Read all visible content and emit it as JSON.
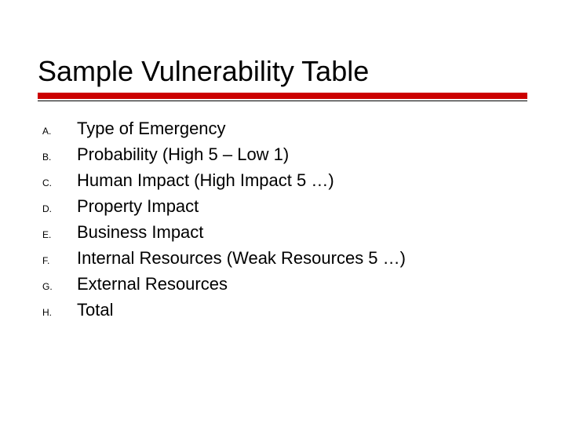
{
  "title": "Sample Vulnerability Table",
  "items": [
    {
      "marker": "A.",
      "text": "Type of Emergency"
    },
    {
      "marker": "B.",
      "text": "Probability (High 5 – Low 1)"
    },
    {
      "marker": "C.",
      "text": "Human Impact (High Impact 5 …)"
    },
    {
      "marker": "D.",
      "text": "Property Impact"
    },
    {
      "marker": "E.",
      "text": "Business Impact"
    },
    {
      "marker": "F.",
      "text": "Internal Resources (Weak Resources 5 …)"
    },
    {
      "marker": "G.",
      "text": "External Resources"
    },
    {
      "marker": "H.",
      "text": "Total"
    }
  ]
}
